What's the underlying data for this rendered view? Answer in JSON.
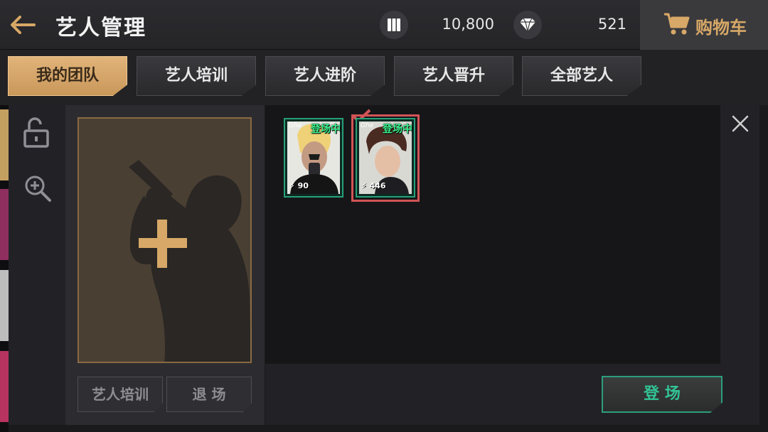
{
  "header": {
    "title": "艺人管理",
    "resource1_value": "10,800",
    "resource2_value": "521",
    "cart_label": "购物车"
  },
  "tabs": [
    {
      "label": "我的团队",
      "active": true
    },
    {
      "label": "艺人培训",
      "active": false
    },
    {
      "label": "艺人进阶",
      "active": false
    },
    {
      "label": "艺人晋升",
      "active": false
    },
    {
      "label": "全部艺人",
      "active": false
    }
  ],
  "detail": {
    "train_button": "艺人培训",
    "exit_button": "退 场"
  },
  "cards": [
    {
      "badge": "登场中",
      "logo": "Ghe",
      "power": "90",
      "selected": false
    },
    {
      "badge": "登场中",
      "logo": "Ghe",
      "power": "446",
      "selected": true
    }
  ],
  "debut_button": "登 场",
  "colors": {
    "accent_gold": "#d7a867",
    "accent_green": "#32c495",
    "select_red": "#d25456"
  }
}
